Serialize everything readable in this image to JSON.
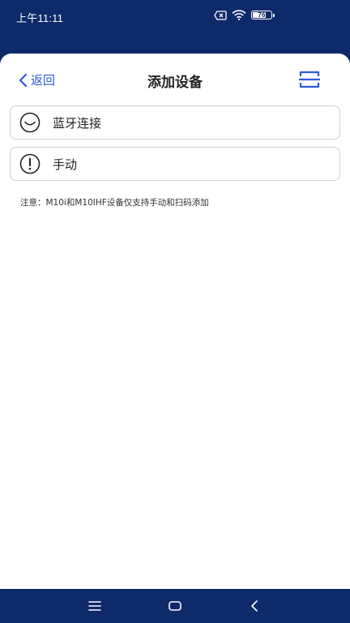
{
  "status_bar": {
    "time": "上午11:11",
    "battery_level": "76"
  },
  "header": {
    "back_label": "返回",
    "title": "添加设备"
  },
  "options": [
    {
      "label": "蓝牙连接",
      "icon": "bluetooth-connect-icon"
    },
    {
      "label": "手动",
      "icon": "alert-circle-icon"
    }
  ],
  "note": "注意：M10i和M10IHF设备仅支持手动和扫码添加",
  "colors": {
    "brand_dark": "#0f2a6a",
    "accent_blue": "#2d5bd6",
    "border": "#cfcfcf"
  }
}
